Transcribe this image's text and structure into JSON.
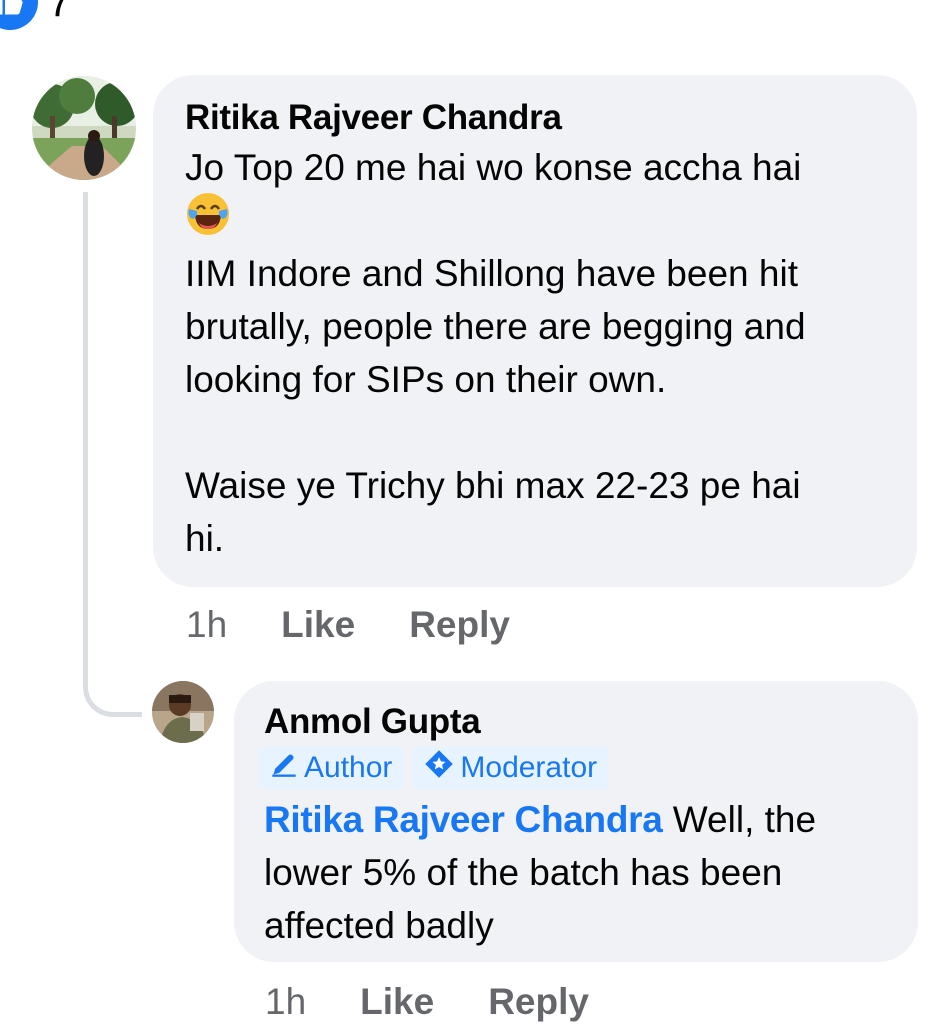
{
  "top_reaction": {
    "count": "7",
    "icon": "like-icon"
  },
  "comments": [
    {
      "author": "Ritika Rajveer Chandra",
      "avatar_icon": "profile-photo-outdoor",
      "paragraphs": [
        "Jo Top 20 me hai wo konse accha hai",
        "IIM Indore and Shillong have been hit\nbrutally, people there are begging and\nlooking for SIPs on their own.",
        "Waise ye Trichy bhi max 22-23 pe hai\nhi."
      ],
      "emoji": "laughing-tears-emoji",
      "time": "1h",
      "like_label": "Like",
      "reply_label": "Reply"
    },
    {
      "author": "Anmol Gupta",
      "avatar_icon": "profile-photo",
      "badges": [
        {
          "label": "Author",
          "icon": "pencil-icon"
        },
        {
          "label": "Moderator",
          "icon": "shield-star-icon"
        }
      ],
      "mention": "Ritika Rajveer Chandra",
      "text": " Well, the\nlower 5% of the batch has been\naffected badly",
      "time": "1h",
      "like_label": "Like",
      "reply_label": "Reply"
    }
  ],
  "colors": {
    "accent": "#1877f2",
    "bubble": "#f0f2f5",
    "muted": "#65676b",
    "thread": "#dadde1"
  }
}
